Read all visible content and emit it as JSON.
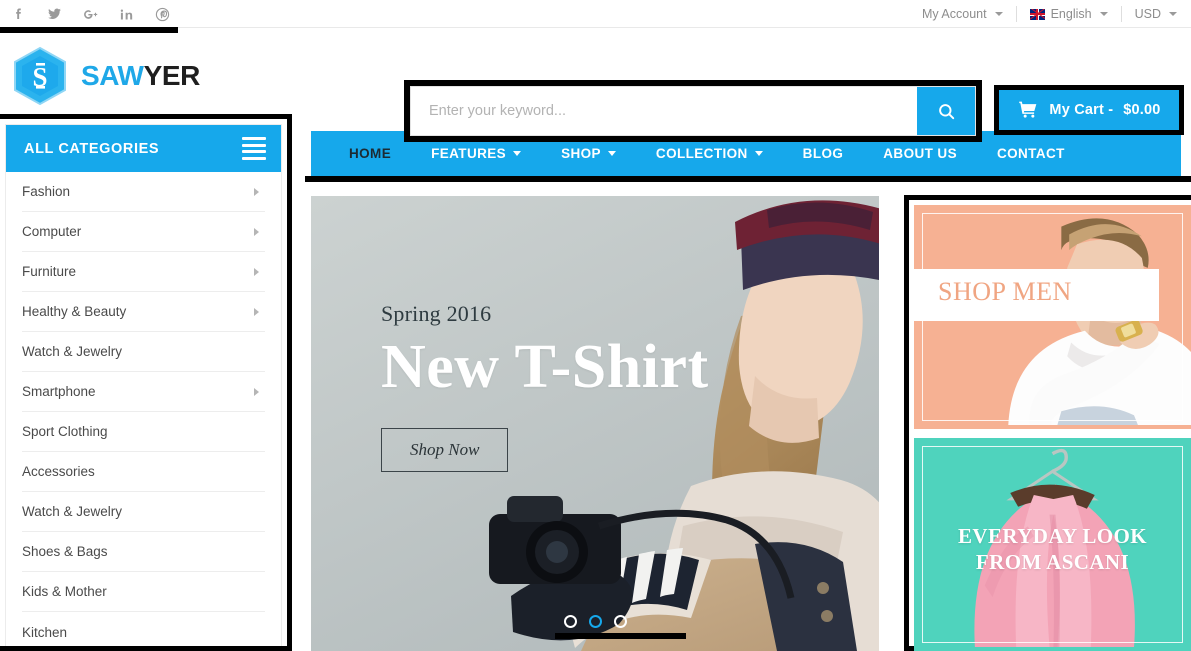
{
  "topbar": {
    "social": [
      {
        "name": "facebook-icon",
        "label": "Facebook"
      },
      {
        "name": "twitter-icon",
        "label": "Twitter"
      },
      {
        "name": "google-plus-icon",
        "label": "Google Plus"
      },
      {
        "name": "linkedin-icon",
        "label": "LinkedIn"
      },
      {
        "name": "pinterest-icon",
        "label": "Pinterest"
      }
    ],
    "account": "My Account",
    "language": "English",
    "currency": "USD"
  },
  "header": {
    "logo_primary": "SAW",
    "logo_secondary": "YER",
    "logo_mark": "S",
    "search_placeholder": "Enter your keyword...",
    "search_value": "",
    "search_icon": "search-icon",
    "cart_label": "My Cart -",
    "cart_total": "$0.00",
    "cart_icon": "shopping-cart-icon"
  },
  "sidebar": {
    "title": "ALL CATEGORIES",
    "menu_icon": "hamburger-icon",
    "items": [
      {
        "label": "Fashion",
        "has_children": true
      },
      {
        "label": "Computer",
        "has_children": true
      },
      {
        "label": "Furniture",
        "has_children": true
      },
      {
        "label": "Healthy & Beauty",
        "has_children": true
      },
      {
        "label": "Watch & Jewelry",
        "has_children": false
      },
      {
        "label": "Smartphone",
        "has_children": true
      },
      {
        "label": "Sport Clothing",
        "has_children": false
      },
      {
        "label": "Accessories",
        "has_children": false
      },
      {
        "label": "Watch & Jewelry",
        "has_children": false
      },
      {
        "label": "Shoes & Bags",
        "has_children": false
      },
      {
        "label": "Kids & Mother",
        "has_children": false
      },
      {
        "label": "Kitchen",
        "has_children": false
      }
    ]
  },
  "nav": {
    "items": [
      {
        "label": "HOME",
        "has_dropdown": false,
        "active": true
      },
      {
        "label": "FEATURES",
        "has_dropdown": true,
        "active": false
      },
      {
        "label": "SHOP",
        "has_dropdown": true,
        "active": false
      },
      {
        "label": "COLLECTION",
        "has_dropdown": true,
        "active": false
      },
      {
        "label": "BLOG",
        "has_dropdown": false,
        "active": false
      },
      {
        "label": "ABOUT US",
        "has_dropdown": false,
        "active": false
      },
      {
        "label": "CONTACT",
        "has_dropdown": false,
        "active": false
      }
    ]
  },
  "hero": {
    "subtitle": "Spring 2016",
    "title": "New T-Shirt",
    "cta": "Shop Now",
    "slides": [
      {
        "active": false
      },
      {
        "active": true
      },
      {
        "active": false
      }
    ]
  },
  "banners": {
    "men": {
      "label": "SHOP MEN",
      "bg_color": "#f6b193"
    },
    "women": {
      "line1": "EVERYDAY LOOK",
      "line2": "FROM ASCANI",
      "bg_color": "#4fd3bd"
    }
  },
  "colors": {
    "accent": "#16a8eb",
    "logo_blue": "#1fa8e8",
    "annotation": "#000000",
    "hero_bg": "#c4cbca"
  }
}
